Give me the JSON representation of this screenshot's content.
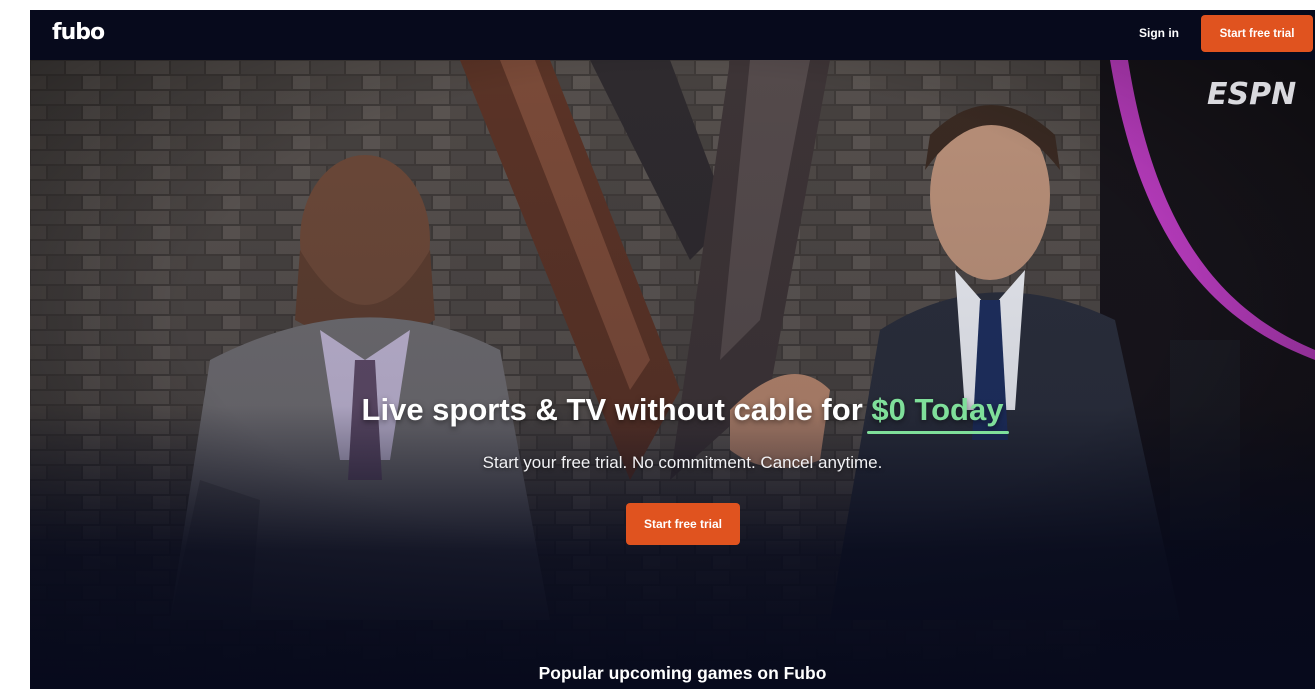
{
  "nav": {
    "logo_text": "fubo",
    "signin_label": "Sign in",
    "cta_label": "Start free trial"
  },
  "hero": {
    "network_logo": "ESPN",
    "headline_prefix": "Live sports & TV without cable for ",
    "headline_accent": "$0 Today",
    "subhead": "Start your free trial. No commitment. Cancel anytime.",
    "cta_label": "Start free trial",
    "image_icon": "studio-hosts-photo"
  },
  "section": {
    "title": "Popular upcoming games on Fubo"
  },
  "colors": {
    "background": "#070a1c",
    "cta": "#e0531f",
    "accent": "#7fdf9a"
  }
}
